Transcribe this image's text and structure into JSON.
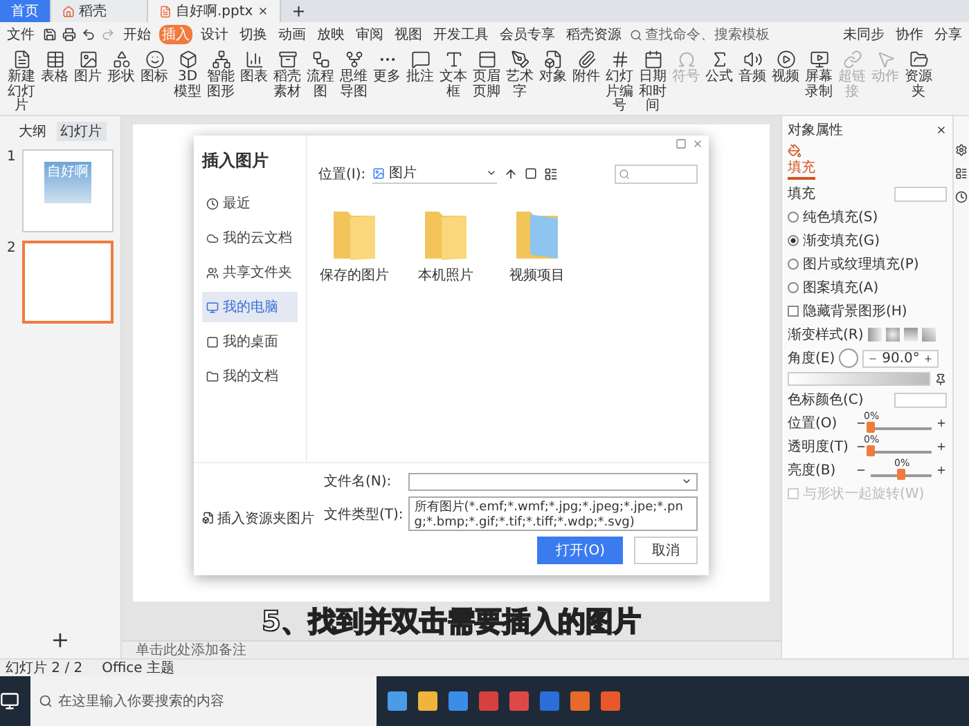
{
  "tabs": [
    {
      "label": "首页",
      "selected": false,
      "kind": "home"
    },
    {
      "label": "稻壳",
      "selected": false,
      "kind": "store"
    },
    {
      "label": "自好啊.pptx",
      "selected": true,
      "kind": "doc"
    }
  ],
  "new_tab": "+",
  "menu": {
    "file": "文件",
    "items": [
      {
        "label": "开始",
        "selected": false
      },
      {
        "label": "插入",
        "selected": true
      },
      {
        "label": "设计",
        "selected": false
      },
      {
        "label": "切换",
        "selected": false
      },
      {
        "label": "动画",
        "selected": false
      },
      {
        "label": "放映",
        "selected": false
      },
      {
        "label": "审阅",
        "selected": false
      },
      {
        "label": "视图",
        "selected": false
      },
      {
        "label": "开发工具",
        "selected": false
      },
      {
        "label": "会员专享",
        "selected": false
      },
      {
        "label": "稻壳资源",
        "selected": false
      }
    ],
    "search": {
      "placeholder": "查找命令、搜索模板"
    },
    "right": [
      "未同步",
      "协作",
      "分享"
    ]
  },
  "ribbon": [
    {
      "label": "新建幻灯片",
      "disabled": false
    },
    {
      "label": "表格",
      "disabled": false
    },
    {
      "label": "图片",
      "disabled": false
    },
    {
      "label": "形状",
      "disabled": false
    },
    {
      "label": "图标",
      "disabled": false
    },
    {
      "label": "3D模型",
      "disabled": false
    },
    {
      "label": "智能图形",
      "disabled": false
    },
    {
      "label": "图表",
      "disabled": false
    },
    {
      "label": "稻壳素材",
      "disabled": false
    },
    {
      "label": "流程图",
      "disabled": false
    },
    {
      "label": "思维导图",
      "disabled": false
    },
    {
      "label": "更多",
      "disabled": false
    },
    {
      "label": "批注",
      "disabled": false
    },
    {
      "label": "文本框",
      "disabled": false
    },
    {
      "label": "页眉页脚",
      "disabled": false
    },
    {
      "label": "艺术字",
      "disabled": false
    },
    {
      "label": "对象",
      "disabled": false
    },
    {
      "label": "附件",
      "disabled": false
    },
    {
      "label": "幻灯片编号",
      "disabled": false
    },
    {
      "label": "日期和时间",
      "disabled": false
    },
    {
      "label": "符号",
      "disabled": true
    },
    {
      "label": "公式",
      "disabled": false
    },
    {
      "label": "音频",
      "disabled": false
    },
    {
      "label": "视频",
      "disabled": false
    },
    {
      "label": "屏幕录制",
      "disabled": false
    },
    {
      "label": "超链接",
      "disabled": true
    },
    {
      "label": "动作",
      "disabled": true
    },
    {
      "label": "资源夹",
      "disabled": false
    }
  ],
  "left_panel": {
    "tabs": [
      {
        "label": "大纲",
        "selected": false
      },
      {
        "label": "幻灯片",
        "selected": true
      }
    ],
    "slides": [
      {
        "number": "1",
        "title": "自好啊",
        "selected": false
      },
      {
        "number": "2",
        "selected": true
      }
    ],
    "add": "+"
  },
  "dialog": {
    "title": "插入图片",
    "location_label": "位置(I):",
    "location": "图片",
    "nav": [
      {
        "label": "最近",
        "selected": false
      },
      {
        "label": "我的云文档",
        "selected": false
      },
      {
        "label": "共享文件夹",
        "selected": false
      },
      {
        "label": "我的电脑",
        "selected": true
      },
      {
        "label": "我的桌面",
        "selected": false
      },
      {
        "label": "我的文档",
        "selected": false
      }
    ],
    "folders": [
      {
        "name": "保存的图片",
        "kind": "plain"
      },
      {
        "name": "本机照片",
        "kind": "plain"
      },
      {
        "name": "视频项目",
        "kind": "video"
      }
    ],
    "insert_from": "插入资源夹图片",
    "filename_label": "文件名(N):",
    "filetype_label": "文件类型(T):",
    "filetype": "所有图片(*.emf;*.wmf;*.jpg;*.jpeg;*.jpe;*.png;*.bmp;*.gif;*.tif;*.tiff;*.wdp;*.svg)",
    "open": "打开(O)",
    "cancel": "取消"
  },
  "caption": "5、找到并双击需要插入的图片",
  "notes": "单击此处添加备注",
  "panel": {
    "title": "对象属性",
    "tabs": [
      {
        "label": "填充",
        "selected": true
      }
    ],
    "section": "填充",
    "fill_options": [
      {
        "label": "纯色填充(S)",
        "selected": false
      },
      {
        "label": "渐变填充(G)",
        "selected": true
      },
      {
        "label": "图片或纹理填充(P)",
        "selected": false
      },
      {
        "label": "图案填充(A)",
        "selected": false
      }
    ],
    "hide_background": {
      "label": "隐藏背景图形(H)",
      "checked": false
    },
    "gradient_style_label": "渐变样式(R)",
    "angle_label": "角度(E)",
    "angle": "90.0°",
    "stop_color_label": "色标颜色(C)",
    "sliders": [
      {
        "label": "位置(O)",
        "reading": "0%",
        "level": 0
      },
      {
        "label": "透明度(T)",
        "reading": "0%",
        "level": 0
      },
      {
        "label": "亮度(B)",
        "reading": "0%",
        "level": 0.5
      }
    ],
    "rotate_with_shape": {
      "label": "与形状一起旋转(W)",
      "checked": false,
      "disabled": true
    }
  },
  "status_bar": {
    "slide": "幻灯片 2 / 2",
    "theme": "Office 主题"
  },
  "taskbar": {
    "search": {
      "placeholder": "在这里输入你要搜索的内容"
    }
  }
}
